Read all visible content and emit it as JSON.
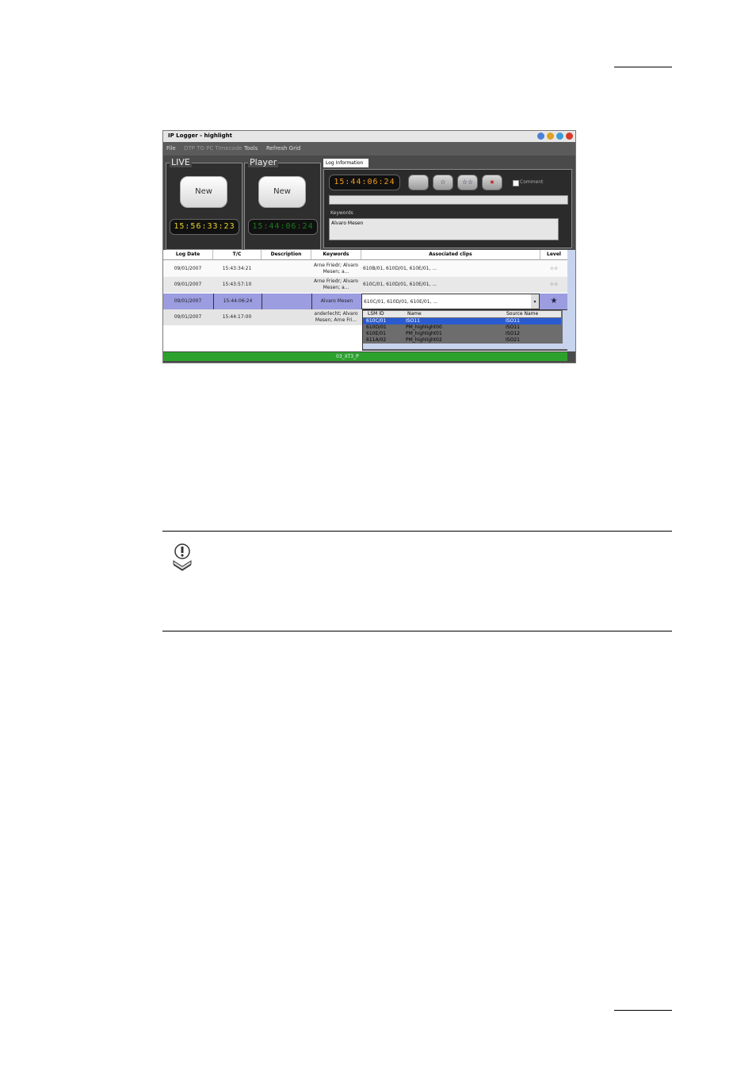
{
  "window": {
    "title": "IP Logger - highlight"
  },
  "menu": [
    "File",
    "DTP TO PC Timecode",
    "Tools",
    "Refresh Grid"
  ],
  "live": {
    "title": "LIVE",
    "button": "New",
    "timecode": "15:56:33:23"
  },
  "player": {
    "title": "Player",
    "button": "New",
    "timecode": "15:44:06:24"
  },
  "log_info": {
    "tab": "Log Information",
    "timecode": "15:44:06:24",
    "comment_label": "Comment",
    "keywords_label": "Keywords",
    "keywords_value": "Alvaro Mesen",
    "levels": [
      "",
      "☆",
      "☆☆",
      "★"
    ]
  },
  "grid": {
    "headers": [
      "Log Date",
      "T/C",
      "Description",
      "Keywords",
      "Associated clips",
      "Level"
    ],
    "rows": [
      {
        "date": "09/01/2007",
        "tc": "15:43:34:21",
        "desc": "",
        "kw": "Arne Friedr; Alvaro Mesen; a...",
        "clips": "610B/01, 610D/01, 610E/01, ...",
        "level": "☆☆"
      },
      {
        "date": "09/01/2007",
        "tc": "15:43:57:10",
        "desc": "",
        "kw": "Arne Friedr; Alvaro Mesen; a...",
        "clips": "610C/01, 610D/01, 610E/01, ...",
        "level": "☆☆"
      },
      {
        "date": "09/01/2007",
        "tc": "15:44:06:24",
        "desc": "",
        "kw": "Alvaro Mesen",
        "clips": "610C/01, 610D/01, 610E/01, ...",
        "level": "★"
      },
      {
        "date": "09/01/2007",
        "tc": "15:44:17:00",
        "desc": "",
        "kw": "anderlecht; Alvaro Mesen; Arne Fri...",
        "clips": "",
        "level": ""
      }
    ]
  },
  "dropdown": {
    "headers": [
      "LSM ID",
      "Name",
      "Source Name"
    ],
    "rows": [
      [
        "610C/01",
        "ISO11",
        "ISO11"
      ],
      [
        "610D/01",
        "PM_highlight00",
        "ISO11"
      ],
      [
        "610E/01",
        "PM_highlight01",
        "ISO12"
      ],
      [
        "611A/02",
        "PM_highlight02",
        "ISO21"
      ]
    ]
  },
  "status": "03_XT3_P"
}
